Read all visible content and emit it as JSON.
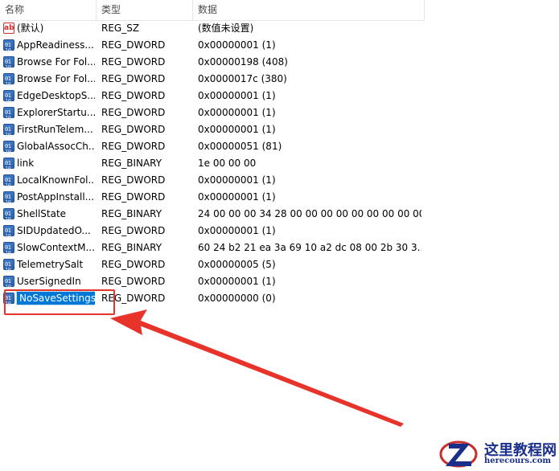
{
  "columns": {
    "name": "名称",
    "type": "类型",
    "data": "数据"
  },
  "rows": [
    {
      "icon": "string-value-icon",
      "name": "(默认)",
      "type": "REG_SZ",
      "data": "(数值未设置)"
    },
    {
      "icon": "binary-value-icon",
      "name": "AppReadiness...",
      "type": "REG_DWORD",
      "data": "0x00000001 (1)"
    },
    {
      "icon": "binary-value-icon",
      "name": "Browse For Fol...",
      "type": "REG_DWORD",
      "data": "0x00000198 (408)"
    },
    {
      "icon": "binary-value-icon",
      "name": "Browse For Fol...",
      "type": "REG_DWORD",
      "data": "0x0000017c (380)"
    },
    {
      "icon": "binary-value-icon",
      "name": "EdgeDesktopS...",
      "type": "REG_DWORD",
      "data": "0x00000001 (1)"
    },
    {
      "icon": "binary-value-icon",
      "name": "ExplorerStartu...",
      "type": "REG_DWORD",
      "data": "0x00000001 (1)"
    },
    {
      "icon": "binary-value-icon",
      "name": "FirstRunTelem...",
      "type": "REG_DWORD",
      "data": "0x00000001 (1)"
    },
    {
      "icon": "binary-value-icon",
      "name": "GlobalAssocCh...",
      "type": "REG_DWORD",
      "data": "0x00000051 (81)"
    },
    {
      "icon": "binary-value-icon",
      "name": "link",
      "type": "REG_BINARY",
      "data": "1e 00 00 00"
    },
    {
      "icon": "binary-value-icon",
      "name": "LocalKnownFol...",
      "type": "REG_DWORD",
      "data": "0x00000001 (1)"
    },
    {
      "icon": "binary-value-icon",
      "name": "PostAppInstall...",
      "type": "REG_DWORD",
      "data": "0x00000001 (1)"
    },
    {
      "icon": "binary-value-icon",
      "name": "ShellState",
      "type": "REG_BINARY",
      "data": "24 00 00 00 34 28 00 00 00 00 00 00 00 00 00..."
    },
    {
      "icon": "binary-value-icon",
      "name": "SIDUpdatedO...",
      "type": "REG_DWORD",
      "data": "0x00000001 (1)"
    },
    {
      "icon": "binary-value-icon",
      "name": "SlowContextM...",
      "type": "REG_BINARY",
      "data": "60 24 b2 21 ea 3a 69 10 a2 dc 08 00 2b 30 3..."
    },
    {
      "icon": "binary-value-icon",
      "name": "TelemetrySalt",
      "type": "REG_DWORD",
      "data": "0x00000005 (5)"
    },
    {
      "icon": "binary-value-icon",
      "name": "UserSignedIn",
      "type": "REG_DWORD",
      "data": "0x00000001 (1)"
    },
    {
      "icon": "binary-value-icon",
      "name": "NoSaveSettings",
      "type": "REG_DWORD",
      "data": "0x00000000 (0)",
      "selected": true
    }
  ],
  "annotation": {
    "color": "#e8332a"
  },
  "watermark": {
    "title": "这里教程网",
    "url": "herecours.com"
  }
}
